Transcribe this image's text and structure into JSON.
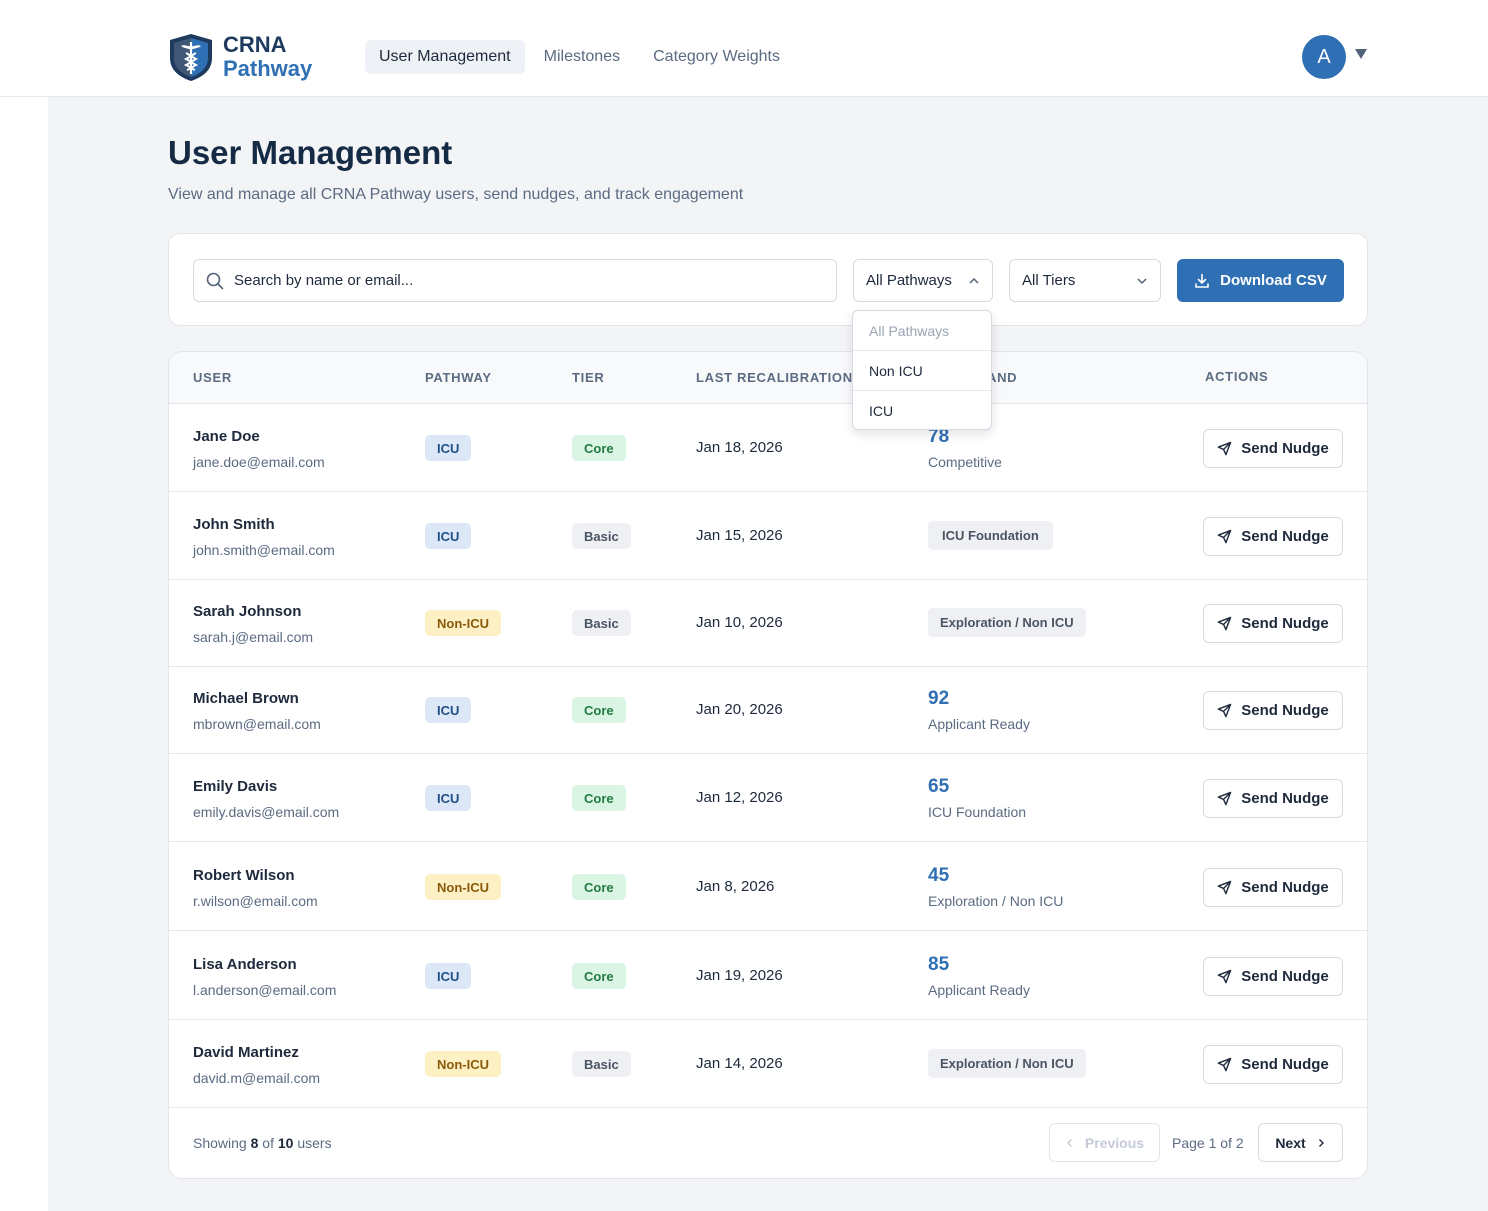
{
  "brand": {
    "line1": "CRNA",
    "line2": "Pathway"
  },
  "nav": {
    "tabs": [
      {
        "label": "User Management",
        "active": true
      },
      {
        "label": "Milestones",
        "active": false
      },
      {
        "label": "Category Weights",
        "active": false
      }
    ]
  },
  "user_menu": {
    "initial": "A",
    "icon": "caret-down-icon"
  },
  "header": {
    "title": "User Management",
    "subtitle": "View and manage all CRNA Pathway users, send nudges, and track engagement"
  },
  "filters": {
    "search_placeholder": "Search by name or email...",
    "pathway_selected": "All Pathways",
    "tier_selected": "All Tiers",
    "download_label": "Download CSV"
  },
  "pathway_dropdown": {
    "options": [
      "All Pathways",
      "Non ICU",
      "ICU"
    ]
  },
  "table": {
    "columns": [
      "USER",
      "PATHWAY",
      "TIER",
      "LAST RECALIBRATION",
      "AND",
      "ACTIONS"
    ],
    "action_label": "Send Nudge",
    "rows": [
      {
        "name": "Jane Doe",
        "email": "jane.doe@email.com",
        "pathway": "ICU",
        "tier": "Core",
        "date": "Jan 18, 2026",
        "score": "78",
        "band": "Competitive"
      },
      {
        "name": "John Smith",
        "email": "john.smith@email.com",
        "pathway": "ICU",
        "tier": "Basic",
        "date": "Jan 15, 2026",
        "score": "",
        "band": "ICU Foundation"
      },
      {
        "name": "Sarah Johnson",
        "email": "sarah.j@email.com",
        "pathway": "Non-ICU",
        "tier": "Basic",
        "date": "Jan 10, 2026",
        "score": "",
        "band": "Exploration / Non ICU"
      },
      {
        "name": "Michael Brown",
        "email": "mbrown@email.com",
        "pathway": "ICU",
        "tier": "Core",
        "date": "Jan 20, 2026",
        "score": "92",
        "band": "Applicant Ready"
      },
      {
        "name": "Emily Davis",
        "email": "emily.davis@email.com",
        "pathway": "ICU",
        "tier": "Core",
        "date": "Jan 12, 2026",
        "score": "65",
        "band": "ICU Foundation"
      },
      {
        "name": "Robert Wilson",
        "email": "r.wilson@email.com",
        "pathway": "Non-ICU",
        "tier": "Core",
        "date": "Jan 8, 2026",
        "score": "45",
        "band": "Exploration / Non ICU"
      },
      {
        "name": "Lisa Anderson",
        "email": "l.anderson@email.com",
        "pathway": "ICU",
        "tier": "Core",
        "date": "Jan 19, 2026",
        "score": "85",
        "band": "Applicant Ready"
      },
      {
        "name": "David Martinez",
        "email": "david.m@email.com",
        "pathway": "Non-ICU",
        "tier": "Basic",
        "date": "Jan 14, 2026",
        "score": "",
        "band": "Exploration / Non ICU"
      }
    ]
  },
  "footer": {
    "showing_prefix": "Showing",
    "shown": "8",
    "of": "of",
    "total": "10",
    "suffix": "users",
    "prev_label": "Previous",
    "page_info": "Page 1 of 2",
    "next_label": "Next"
  },
  "colors": {
    "primary": "#2f6fb3",
    "navy": "#152a45",
    "icu": "#dce8f8",
    "non_icu": "#fdf0c4",
    "core": "#daf5e3"
  }
}
